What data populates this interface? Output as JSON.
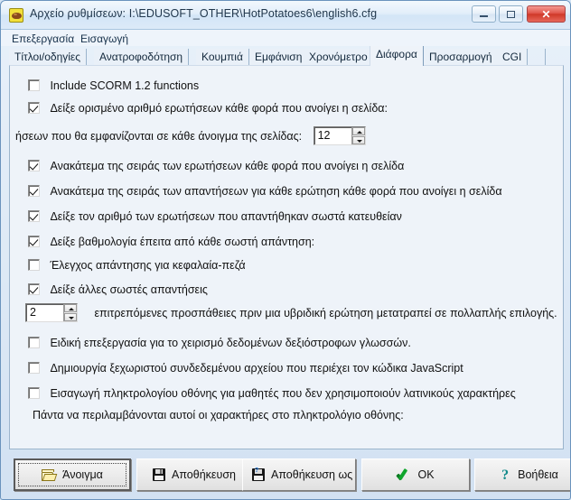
{
  "window": {
    "title": "Αρχείο ρυθμίσεων:  I:\\EDUSOFT_OTHER\\HotPotatoes6\\english6.cfg",
    "icon": "potato-icon",
    "minimize_label": "",
    "maximize_label": "",
    "close_label": "✕"
  },
  "menubar": {
    "items": [
      {
        "label": "Επεξεργασία"
      },
      {
        "label": "Εισαγωγή"
      }
    ]
  },
  "tabs": [
    {
      "label": "Τίτλοι/οδηγίες",
      "selected": false
    },
    {
      "label": "Ανατροφοδότηση",
      "selected": false
    },
    {
      "label": "Κουμπιά",
      "selected": false
    },
    {
      "label": "Εμφάνιση",
      "selected": false
    },
    {
      "label": "Χρονόμετρο",
      "selected": false
    },
    {
      "label": "Διάφορα",
      "selected": true
    },
    {
      "label": "Προσαρμογή",
      "selected": false
    },
    {
      "label": "CGI",
      "selected": false
    }
  ],
  "panel": {
    "checkboxes": {
      "scorm": {
        "label": "Include SCORM 1.2 functions",
        "checked": false
      },
      "show_number": {
        "label": "Δείξε ορισμένο αριθμό ερωτήσεων κάθε φορά που ανοίγει η σελίδα:",
        "checked": true
      },
      "shuffle_questions": {
        "label": "Ανακάτεμα της σειράς των ερωτήσεων κάθε φορά που ανοίγει η σελίδα",
        "checked": true
      },
      "shuffle_answers": {
        "label": "Ανακάτεμα της σειράς των απαντήσεων για κάθε ερώτηση κάθε φορά που ανοίγει η σελίδα",
        "checked": true
      },
      "show_correct_count": {
        "label": "Δείξε τον αριθμό των ερωτήσεων που απαντήθηκαν σωστά κατευθείαν",
        "checked": true
      },
      "show_score": {
        "label": "Δείξε βαθμολογία έπειτα από κάθε σωστή απάντηση:",
        "checked": true
      },
      "case_sensitive": {
        "label": "Έλεγχος απάντησης για κεφαλαία-πεζά",
        "checked": false
      },
      "show_other_correct": {
        "label": "Δείξε άλλες σωστές απαντήσεις",
        "checked": true
      },
      "rtl_support": {
        "label": "Ειδική επεξεργασία για το χειρισμό δεδομένων δεξιόστροφων γλωσσών.",
        "checked": false
      },
      "external_js": {
        "label": "Δημιουργία ξεχωριστού συνδεδεμένου αρχείου που περιέχει τον κώδικα JavaScript",
        "checked": false
      },
      "onscreen_keyboard": {
        "label": "Εισαγωγή πληκτρολογίου οθόνης για μαθητές που δεν χρησιμοποιούν λατινικούς χαρακτήρες",
        "checked": false
      }
    },
    "questions_per_page": {
      "label": "ήσεων που θα εμφανίζονται σε κάθε άνοιγμα της σελίδας:",
      "value": "12"
    },
    "attempts": {
      "value": "2",
      "label": "επιτρεπόμενες προσπάθειες πριν μια υβριδική ερώτηση μετατραπεί σε πολλαπλής επιλογής."
    },
    "keyboard_chars": {
      "label": "Πάντα να περιλαμβάνονται αυτοί οι χαρακτήρες στο πληκτρολόγιο οθόνης:",
      "value": "",
      "placeholder": ""
    }
  },
  "buttons": {
    "open": {
      "label": "Άνοιγμα",
      "icon": "folder-open-icon",
      "focused": true
    },
    "save": {
      "label": "Αποθήκευση",
      "icon": "floppy-disk-icon"
    },
    "save_as": {
      "label": "Αποθήκευση ως",
      "icon": "floppy-disk-as-icon"
    },
    "ok": {
      "label": "OK",
      "icon": "green-check-icon"
    },
    "help": {
      "label": "Βοήθεια",
      "icon": "question-mark-icon"
    }
  }
}
